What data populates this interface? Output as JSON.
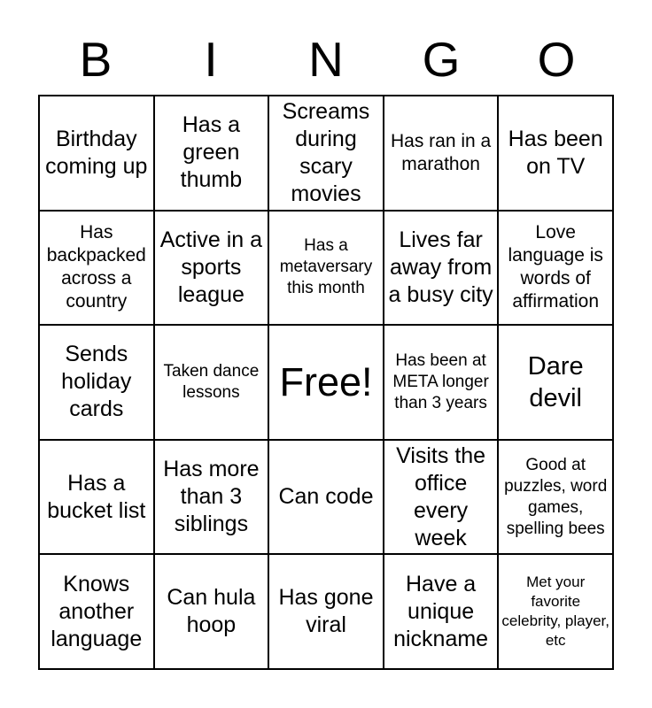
{
  "card": {
    "title": "BINGO",
    "header_letters": [
      "B",
      "I",
      "N",
      "G",
      "O"
    ],
    "columns": 5,
    "rows": 5,
    "colors": {
      "background": "#ffffff",
      "text": "#000000",
      "grid_line": "#000000"
    },
    "free_space": {
      "label": "Free!",
      "row": 3,
      "column": 3
    },
    "rows_data": [
      [
        {
          "text": "Birthday coming up",
          "size": "md"
        },
        {
          "text": "Has a green thumb",
          "size": "md"
        },
        {
          "text": "Screams during scary movies",
          "size": "md"
        },
        {
          "text": "Has ran in a marathon",
          "size": "sm"
        },
        {
          "text": "Has been on TV",
          "size": "md"
        }
      ],
      [
        {
          "text": "Has backpacked across a country",
          "size": "sm"
        },
        {
          "text": "Active in a sports league",
          "size": "md"
        },
        {
          "text": "Has a metaversary this month",
          "size": "xs"
        },
        {
          "text": "Lives far away from a busy city",
          "size": "md"
        },
        {
          "text": "Love language is words of affirmation",
          "size": "sm"
        }
      ],
      [
        {
          "text": "Sends holiday cards",
          "size": "md"
        },
        {
          "text": "Taken dance lessons",
          "size": "xs"
        },
        {
          "text": "Free!",
          "size": "xl"
        },
        {
          "text": "Has been at META longer than 3 years",
          "size": "xs"
        },
        {
          "text": "Dare devil",
          "size": "lg"
        }
      ],
      [
        {
          "text": "Has a bucket list",
          "size": "md"
        },
        {
          "text": "Has more than 3 siblings",
          "size": "md"
        },
        {
          "text": "Can code",
          "size": "md"
        },
        {
          "text": "Visits the office every week",
          "size": "md"
        },
        {
          "text": "Good at puzzles, word games, spelling bees",
          "size": "xs"
        }
      ],
      [
        {
          "text": "Knows another language",
          "size": "md"
        },
        {
          "text": "Can hula hoop",
          "size": "md"
        },
        {
          "text": "Has gone viral",
          "size": "md"
        },
        {
          "text": "Have a unique nickname",
          "size": "md"
        },
        {
          "text": "Met your favorite celebrity, player, etc",
          "size": "xxs"
        }
      ]
    ]
  }
}
